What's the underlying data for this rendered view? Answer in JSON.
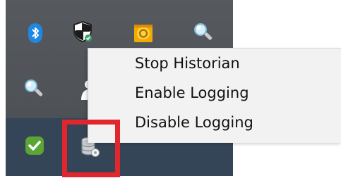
{
  "context_menu": {
    "items": [
      {
        "label": "Stop Historian"
      },
      {
        "label": "Enable Logging"
      },
      {
        "label": "Disable Logging"
      }
    ]
  },
  "tray": {
    "icons": [
      {
        "name": "bluetooth-icon",
        "color": "#1e88e5"
      },
      {
        "name": "windows-security-shield-icon",
        "color": "#ffffff"
      },
      {
        "name": "outlook-icon",
        "color": "#f2a900"
      },
      {
        "name": "magnifier-icon",
        "color": "#9fd3ef"
      },
      {
        "name": "magnifier-icon",
        "color": "#9fd3ef"
      },
      {
        "name": "user-icon",
        "color": "#ffffff"
      },
      {
        "name": "green-check-icon",
        "color": "#5aa534"
      },
      {
        "name": "historian-database-icon",
        "color": "#c9ccd1"
      }
    ]
  },
  "annotation": {
    "highlight_color": "#e1262d"
  }
}
